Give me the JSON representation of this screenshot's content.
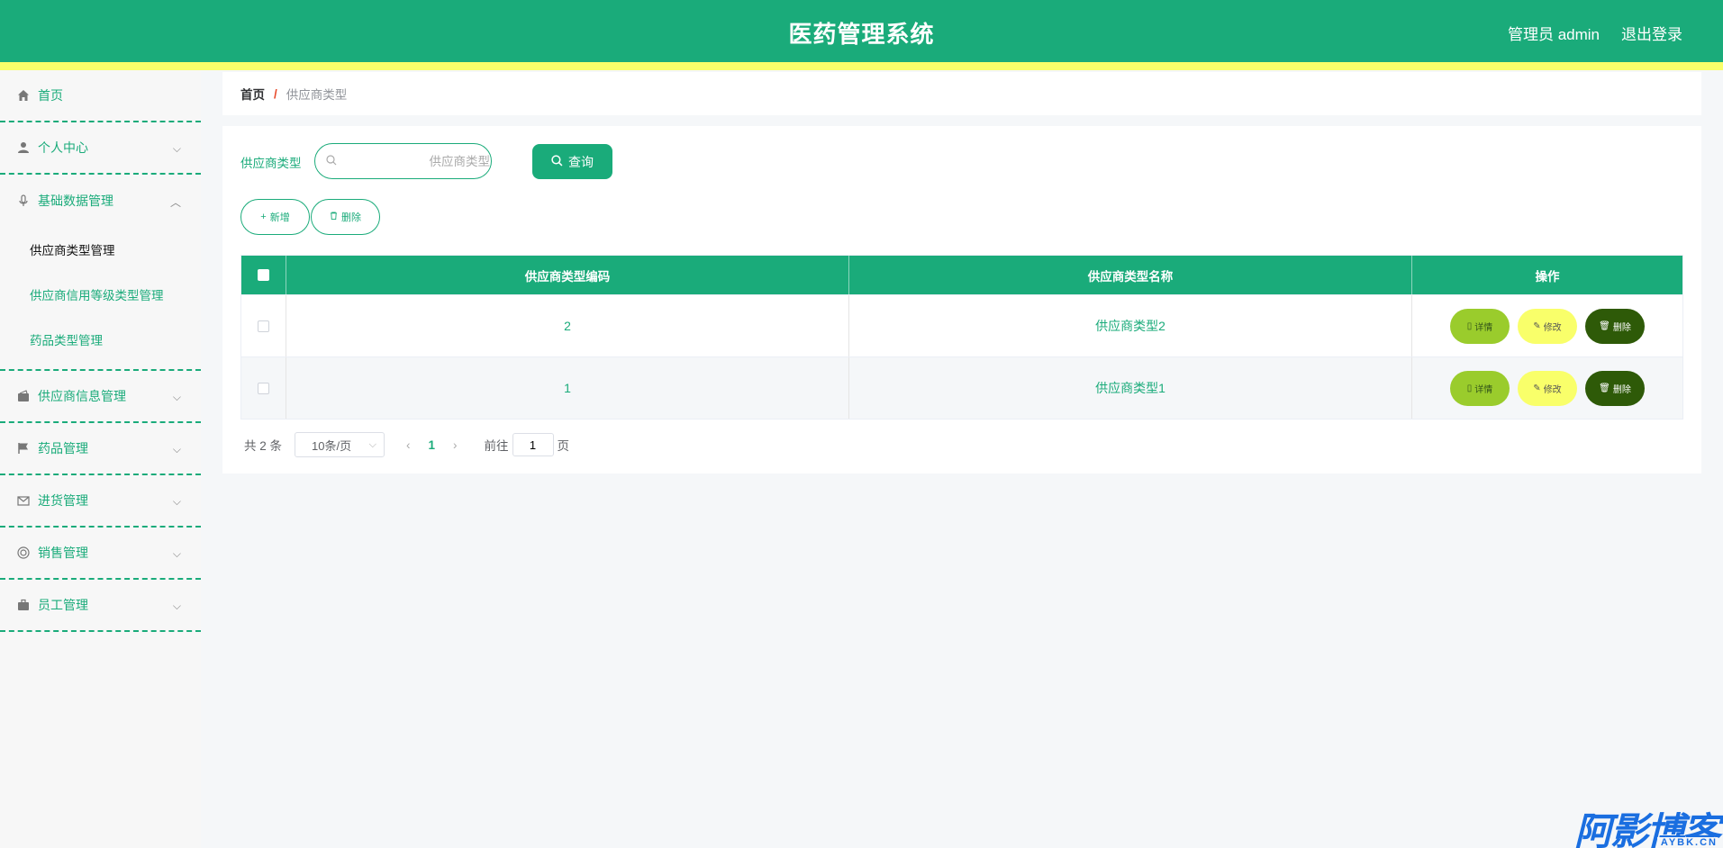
{
  "header": {
    "title": "医药管理系统",
    "user_label": "管理员 admin",
    "logout_label": "退出登录"
  },
  "sidebar": {
    "items": [
      {
        "label": "首页",
        "icon": "home-icon"
      },
      {
        "label": "个人中心",
        "icon": "user-icon"
      },
      {
        "label": "基础数据管理",
        "icon": "microphone-icon"
      },
      {
        "label": "供应商信息管理",
        "icon": "wallet-icon"
      },
      {
        "label": "药品管理",
        "icon": "flag-icon"
      },
      {
        "label": "进货管理",
        "icon": "mail-icon"
      },
      {
        "label": "销售管理",
        "icon": "lifebuoy-icon"
      },
      {
        "label": "员工管理",
        "icon": "briefcase-icon"
      }
    ],
    "sub_items": [
      "供应商类型管理",
      "供应商信用等级类型管理",
      "药品类型管理"
    ]
  },
  "breadcrumb": {
    "home": "首页",
    "separator": "/",
    "current": "供应商类型"
  },
  "search": {
    "label": "供应商类型",
    "placeholder": "供应商类型",
    "query_button": "查询"
  },
  "actions": {
    "add": "新增",
    "delete": "删除"
  },
  "table": {
    "columns": [
      "供应商类型编码",
      "供应商类型名称",
      "操作"
    ],
    "rows": [
      {
        "code": "2",
        "name": "供应商类型2"
      },
      {
        "code": "1",
        "name": "供应商类型1"
      }
    ],
    "ops": {
      "detail": "详情",
      "edit": "修改",
      "delete": "删除"
    }
  },
  "pagination": {
    "total": "共 2 条",
    "page_size": "10条/页",
    "current_page": "1",
    "goto_prefix": "前往",
    "goto_value": "1",
    "goto_suffix": "页"
  },
  "watermark": {
    "main": "阿影博客",
    "sub": "AYBK.CN"
  },
  "colors": {
    "primary": "#1aab7a",
    "stripe": "#f9ff6a",
    "detail": "#9acc2c",
    "delete": "#2e5a08"
  }
}
